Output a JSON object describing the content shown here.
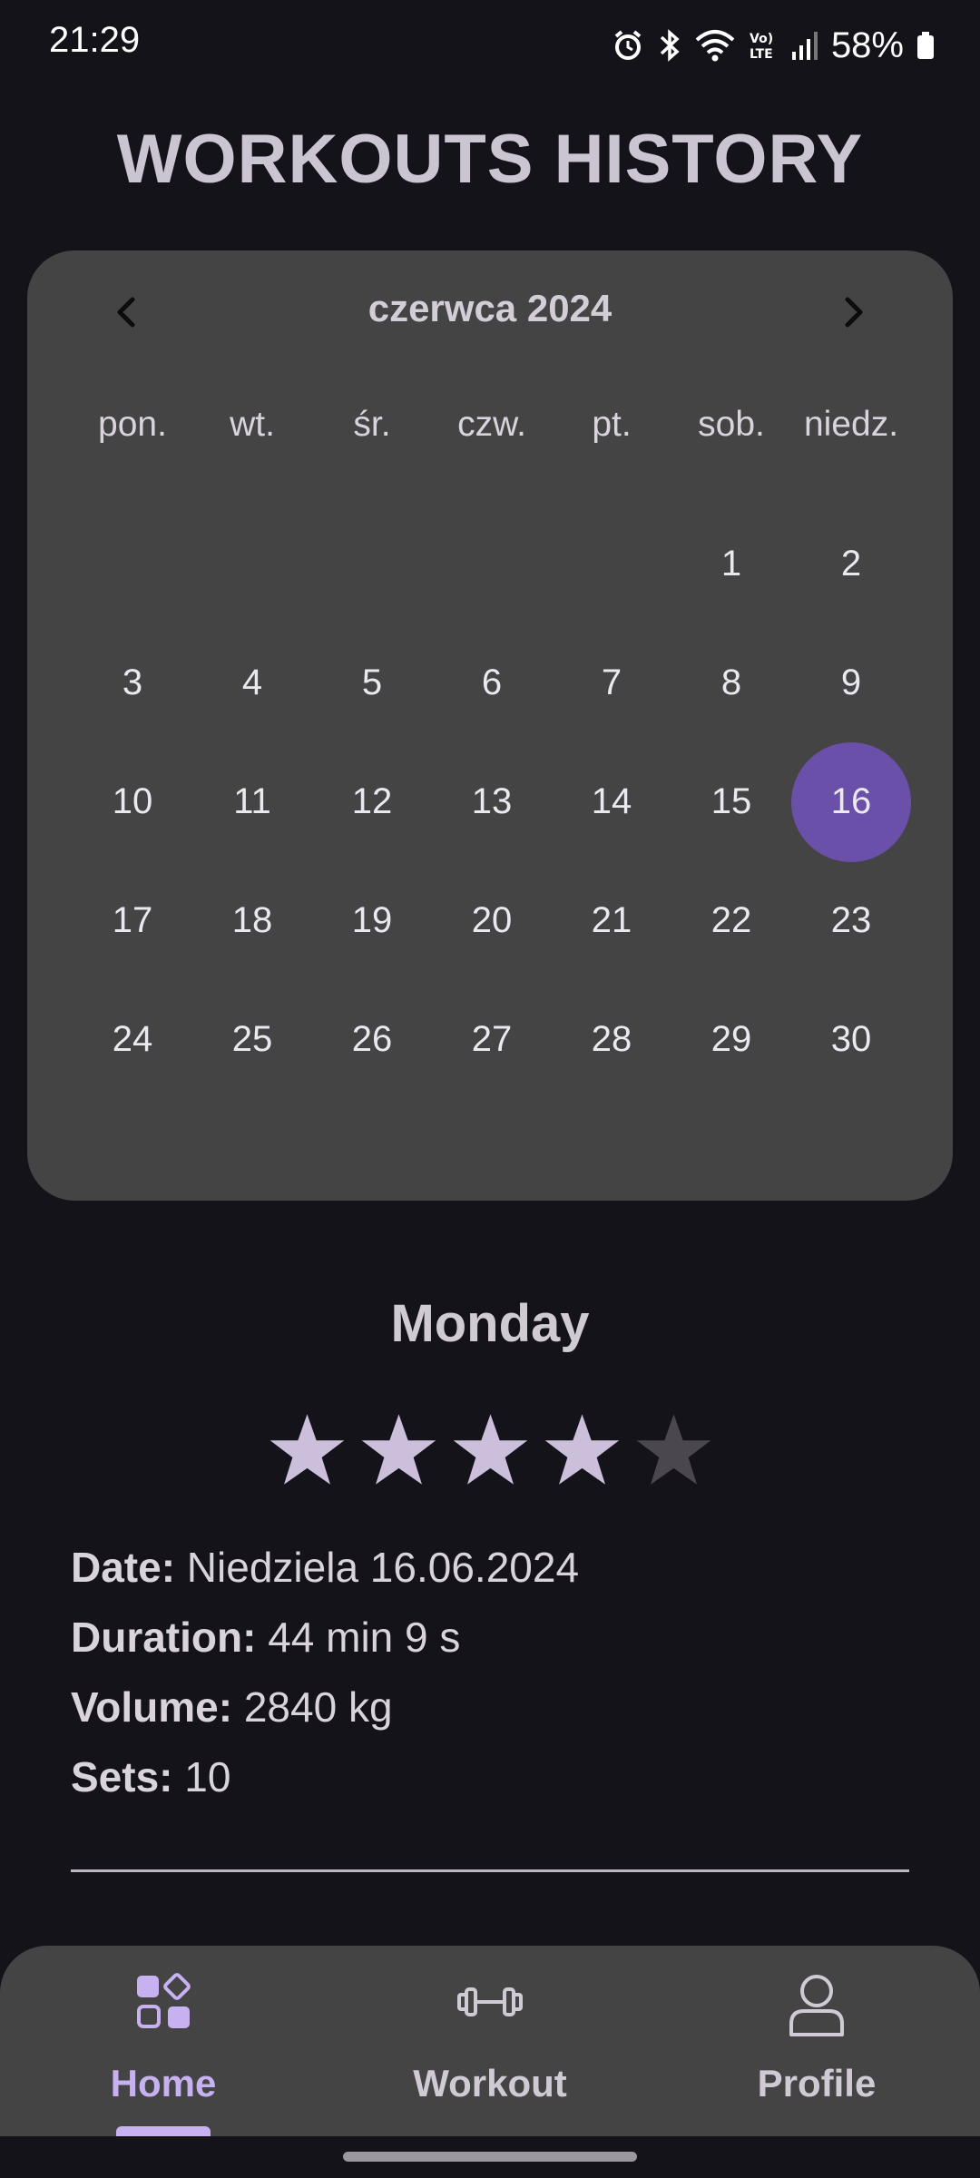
{
  "status_bar": {
    "time": "21:29",
    "battery": "58%",
    "icons": [
      "alarm-icon",
      "bluetooth-icon",
      "wifi-icon",
      "volte-icon",
      "signal-icon",
      "battery-icon"
    ]
  },
  "header": {
    "title": "WORKOUTS HISTORY"
  },
  "calendar": {
    "month_label": "czerwca 2024",
    "weekdays": [
      "pon.",
      "wt.",
      "śr.",
      "czw.",
      "pt.",
      "sob.",
      "niedz."
    ],
    "leading_empty_days": 5,
    "days": [
      "1",
      "2",
      "3",
      "4",
      "5",
      "6",
      "7",
      "8",
      "9",
      "10",
      "11",
      "12",
      "13",
      "14",
      "15",
      "16",
      "17",
      "18",
      "19",
      "20",
      "21",
      "22",
      "23",
      "24",
      "25",
      "26",
      "27",
      "28",
      "29",
      "30"
    ],
    "selected_day": "16",
    "selected_color": "#6a50a8"
  },
  "workout": {
    "day_name": "Monday",
    "rating": 4,
    "rating_max": 5,
    "star_color": "#cbbfdc",
    "star_empty_color": "#4a474f",
    "date_label": "Date:",
    "date_value": " Niedziela 16.06.2024",
    "duration_label": "Duration:",
    "duration_value": " 44 min 9 s",
    "volume_label": "Volume:",
    "volume_value": " 2840 kg",
    "sets_label": "Sets:",
    "sets_value": " 10"
  },
  "bottom_nav": {
    "items": [
      {
        "label": "Home",
        "icon": "home-grid-icon",
        "active": true
      },
      {
        "label": "Workout",
        "icon": "dumbbell-icon",
        "active": false
      },
      {
        "label": "Profile",
        "icon": "person-icon",
        "active": false
      }
    ],
    "active_color": "#c8b1f0"
  }
}
